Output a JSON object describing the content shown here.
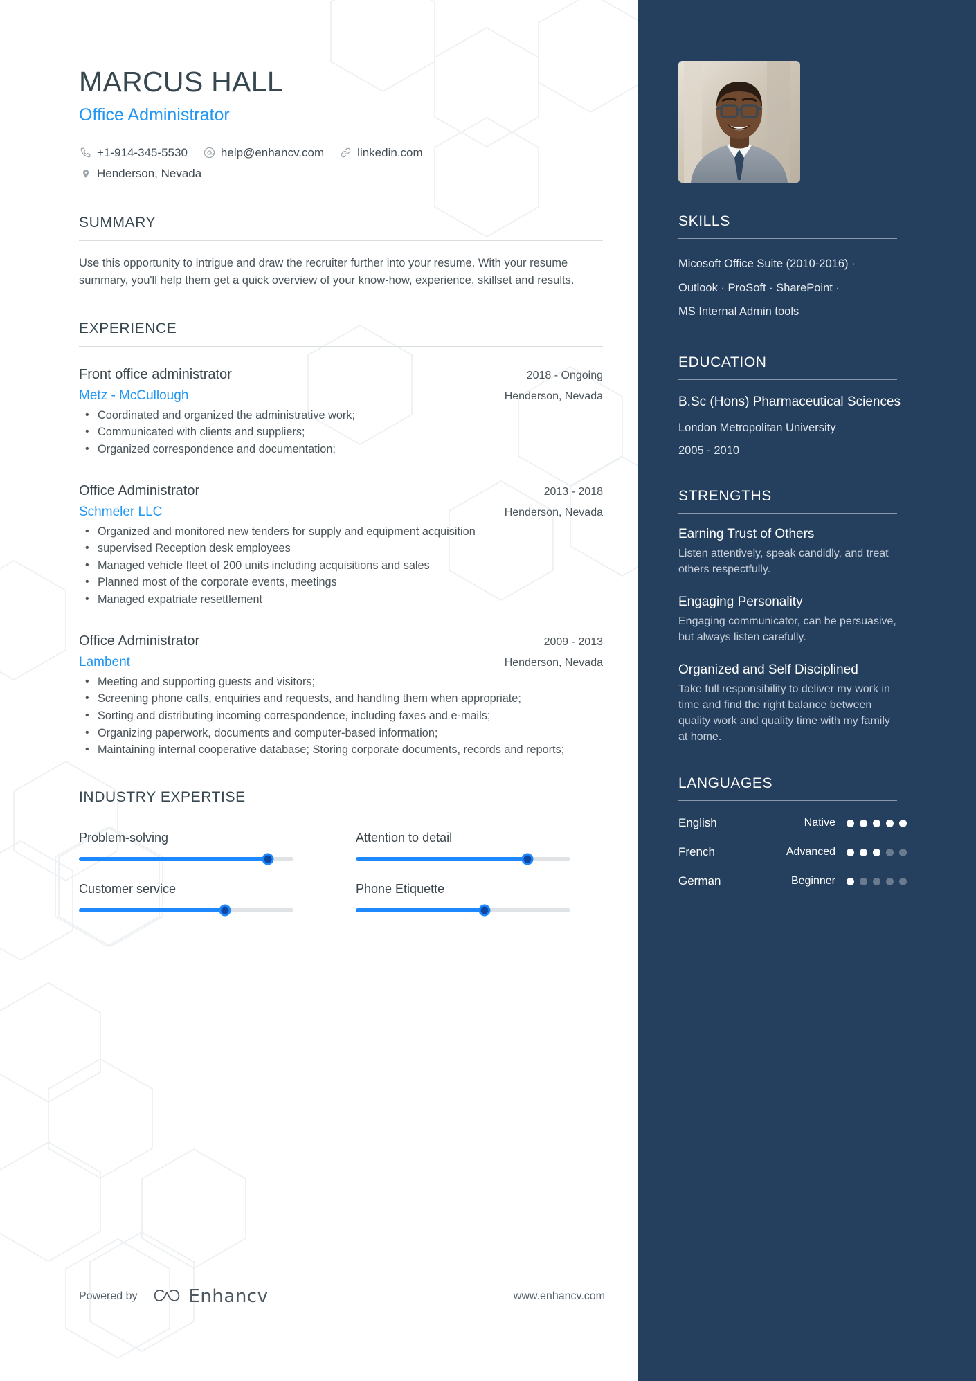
{
  "theme": {
    "accent_blue": "#2196f3",
    "sidebar_bg": "#25405e",
    "slider_fill": "#1e88ff",
    "heading_color": "#37474f"
  },
  "header": {
    "name": "MARCUS HALL",
    "job_title": "Office Administrator",
    "contacts": [
      {
        "icon": "phone-icon",
        "text": "+1-914-345-5530"
      },
      {
        "icon": "email-icon",
        "text": "help@enhancv.com"
      },
      {
        "icon": "link-icon",
        "text": "linkedin.com"
      }
    ],
    "location": {
      "icon": "location-pin-icon",
      "text": "Henderson, Nevada"
    }
  },
  "summary": {
    "heading": "SUMMARY",
    "text": "Use this opportunity to intrigue and draw the recruiter further into your resume. With your resume summary, you'll help them get a quick overview of your know-how, experience, skillset and results."
  },
  "experience": {
    "heading": "EXPERIENCE",
    "items": [
      {
        "role": "Front office administrator",
        "company": "Metz - McCullough",
        "dates": "2018 - Ongoing",
        "location": "Henderson, Nevada",
        "bullets": [
          "Coordinated and organized the administrative work;",
          "Communicated with clients and suppliers;",
          "Organized correspondence and documentation;"
        ]
      },
      {
        "role": "Office Administrator",
        "company": "Schmeler LLC",
        "dates": "2013 - 2018",
        "location": "Henderson, Nevada",
        "bullets": [
          "Organized and monitored new tenders for supply and equipment acquisition",
          "supervised Reception desk employees",
          "Managed vehicle fleet of 200 units including acquisitions and sales",
          "Planned most of the corporate events, meetings",
          "Managed expatriate resettlement"
        ]
      },
      {
        "role": "Office Administrator",
        "company": "Lambent",
        "dates": "2009 - 2013",
        "location": "Henderson, Nevada",
        "bullets": [
          "Meeting and supporting guests and visitors;",
          "Screening phone calls, enquiries and requests, and handling them when appropriate;",
          "Sorting and distributing incoming correspondence, including faxes and e-mails;",
          "Organizing paperwork, documents and computer-based information;",
          "Maintaining internal cooperative database; Storing corporate documents, records and reports;"
        ]
      }
    ]
  },
  "industry_expertise": {
    "heading": "INDUSTRY EXPERTISE",
    "items": [
      {
        "label": "Problem-solving",
        "value": 88
      },
      {
        "label": "Attention to detail",
        "value": 80
      },
      {
        "label": "Customer service",
        "value": 68
      },
      {
        "label": "Phone Etiquette",
        "value": 60
      }
    ]
  },
  "sidebar": {
    "skills": {
      "heading": "SKILLS",
      "lines": [
        "Micosoft Office Suite (2010-2016) ·",
        "Outlook · ProSoft · SharePoint ·",
        "MS Internal Admin tools"
      ]
    },
    "education": {
      "heading": "EDUCATION",
      "degree": "B.Sc (Hons) Pharmaceutical Sciences",
      "school": "London Metropolitan University",
      "years": "2005 - 2010"
    },
    "strengths": {
      "heading": "STRENGTHS",
      "items": [
        {
          "title": "Earning Trust of Others",
          "desc": "Listen attentively, speak candidly, and treat others respectfully."
        },
        {
          "title": "Engaging Personality",
          "desc": "Engaging communicator, can be persuasive, but always listen carefully."
        },
        {
          "title": "Organized and Self Disciplined",
          "desc": "Take full responsibility to deliver my work in time and find the right balance between quality work and quality time with my family at home."
        }
      ]
    },
    "languages": {
      "heading": "LANGUAGES",
      "items": [
        {
          "name": "English",
          "level": "Native",
          "dots": 5,
          "total": 5
        },
        {
          "name": "French",
          "level": "Advanced",
          "dots": 3,
          "total": 5
        },
        {
          "name": "German",
          "level": "Beginner",
          "dots": 1,
          "total": 5
        }
      ]
    },
    "photo_alt": "profile-photo"
  },
  "footer": {
    "powered_by": "Powered by",
    "brand": "Enhancv",
    "website": "www.enhancv.com"
  }
}
